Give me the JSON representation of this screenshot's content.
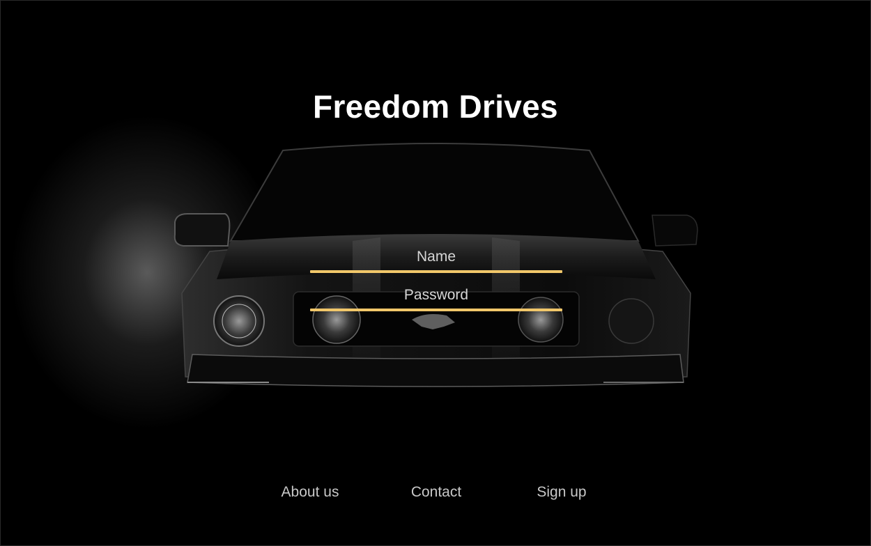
{
  "app": {
    "title": "Freedom Drives"
  },
  "form": {
    "name_label": "Name",
    "password_label": "Password",
    "accent_color": "#f1c76a"
  },
  "footer": {
    "links": [
      {
        "label": "About us"
      },
      {
        "label": "Contact"
      },
      {
        "label": "Sign up"
      }
    ]
  },
  "background": {
    "image": "car-front-silhouette",
    "base_color": "#000000"
  }
}
